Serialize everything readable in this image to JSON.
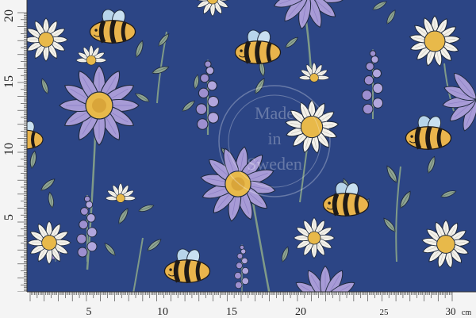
{
  "colors": {
    "fabric_background": "#2c4585",
    "daisy_petal": "#f3f1ea",
    "aster_petal": "#a79bd6",
    "flower_center": "#e8b94a",
    "bee_body": "#e9b44c",
    "bee_stripe": "#1e1a18",
    "bee_wing": "#b7d4ea",
    "lavender": "#9d8fcf",
    "leaf": "#8fa493",
    "stem": "#7f9a88",
    "ruler_face": "#f4f4f4",
    "ruler_line": "#333333"
  },
  "watermark": {
    "lines": [
      "Made",
      "in",
      "Sweden"
    ]
  },
  "ruler_left": {
    "labels": [
      "20",
      "15",
      "10",
      "5"
    ],
    "values": [
      20,
      15,
      10,
      5
    ],
    "max": 20
  },
  "ruler_bottom": {
    "labels": [
      "5",
      "10",
      "15",
      "20",
      "25",
      "30"
    ],
    "values": [
      5,
      10,
      15,
      20,
      25,
      30
    ],
    "unit": "cm",
    "max": 30
  },
  "icons": {
    "pattern": [
      "daisy-icon",
      "aster-icon",
      "bee-icon",
      "lavender-icon",
      "leaf-icon"
    ]
  }
}
